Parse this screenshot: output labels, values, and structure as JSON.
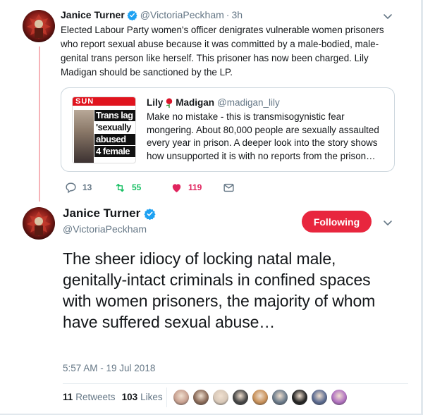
{
  "colors": {
    "accent": "#1da1f2",
    "retweet": "#17bf63",
    "like": "#e0245e",
    "follow_button": "#e8263e",
    "secondary_text": "#657786",
    "thread_line": "#f6b3b8"
  },
  "tweet1": {
    "author_name": "Janice Turner",
    "handle": "@VictoriaPeckham",
    "separator": "·",
    "time": "3h",
    "text": "Elected Labour Party women's officer denigrates vulnerable women prisoners who report sexual abuse because it was committed by a male-bodied, male-genital trans person like herself. This prisoner has now been charged. Lily Madigan should be sanctioned by the LP.",
    "avatar_icon": "avatar-icon",
    "quote": {
      "author_name_prefix": "Lily",
      "author_name_suffix": "Madigan",
      "rose_icon": "rose-icon",
      "handle": "@madigan_lily",
      "text": "Make no mistake - this is transmisogynistic fear mongering. About 80,000 people are sexually assaulted every year in prison. A deeper look into the story shows how unsupported it is with no reports from the prison…",
      "thumbnail": {
        "masthead": "SUN",
        "headline_lines": [
          "Trans lag",
          "'sexually",
          "abused",
          "4 female"
        ]
      }
    },
    "actions": {
      "reply_count": "13",
      "retweet_count": "55",
      "like_count": "119"
    }
  },
  "tweet2": {
    "author_name": "Janice Turner",
    "handle": "@VictoriaPeckham",
    "follow_label": "Following",
    "text": "The sheer idiocy of locking natal male, genitally-intact criminals in confined spaces with women prisoners, the majority of whom have suffered sexual abuse…",
    "timestamp": "5:57 AM - 19 Jul 2018",
    "retweets_count": "11",
    "retweets_label": "Retweets",
    "likes_count": "103",
    "likes_label": "Likes",
    "liker_avatars": [
      "#c8a090",
      "#8a6a58",
      "#d8c8b8",
      "#444444",
      "#c89058",
      "#6a7a8a",
      "#222222",
      "#5a6a90",
      "#b070c0"
    ]
  }
}
